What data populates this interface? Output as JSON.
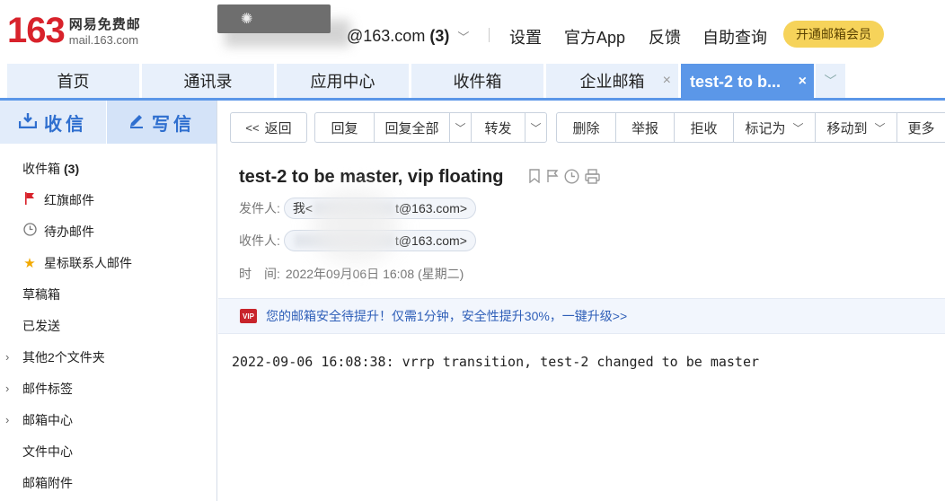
{
  "header": {
    "logo_number": "163",
    "logo_cn": "网易免费邮",
    "logo_url": "mail.163.com",
    "account_suffix": "@163.com",
    "account_count": "(3)",
    "links": [
      "设置",
      "官方App",
      "反馈",
      "自助查询"
    ],
    "vip_button": "开通邮箱会员"
  },
  "tabs": [
    {
      "label": "首页"
    },
    {
      "label": "通讯录"
    },
    {
      "label": "应用中心"
    },
    {
      "label": "收件箱"
    },
    {
      "label": "企业邮箱",
      "close": "×"
    },
    {
      "label": "test-2 to b...",
      "close": "×",
      "active": true
    }
  ],
  "sidebar": {
    "receive": "收信",
    "write": "写信",
    "items": [
      {
        "label": "收件箱",
        "count": "(3)"
      },
      {
        "label": "红旗邮件"
      },
      {
        "label": "待办邮件"
      },
      {
        "label": "星标联系人邮件"
      },
      {
        "label": "草稿箱"
      },
      {
        "label": "已发送"
      },
      {
        "label": "其他2个文件夹"
      },
      {
        "label": "邮件标签"
      },
      {
        "label": "邮箱中心"
      },
      {
        "label": "文件中心"
      },
      {
        "label": "邮箱附件"
      }
    ]
  },
  "toolbar": {
    "back": "返回",
    "reply": "回复",
    "reply_all": "回复全部",
    "forward": "转发",
    "delete": "删除",
    "report": "举报",
    "reject": "拒收",
    "mark_as": "标记为",
    "move_to": "移动到",
    "more": "更多"
  },
  "mail": {
    "subject": "test-2 to be master, vip floating",
    "from_label": "发件人:",
    "from_prefix": "我<",
    "from_suffix": "t@163.com>",
    "to_label": "收件人:",
    "to_suffix": "t@163.com>",
    "time_label": "时　间:",
    "time_value": "2022年09月06日 16:08 (星期二)",
    "banner_tag": "VIP",
    "banner_text": "您的邮箱安全待提升！仅需1分钟，安全性提升30%，一键升级>>",
    "body": "2022-09-06 16:08:38: vrrp transition, test-2 changed to be master"
  },
  "colors": {
    "brand_red": "#d8222b",
    "tab_active": "#5b97e8",
    "tab_bg": "#e8f0fb",
    "vip_yellow": "#f6d35a",
    "link_blue": "#2f5fb8"
  }
}
